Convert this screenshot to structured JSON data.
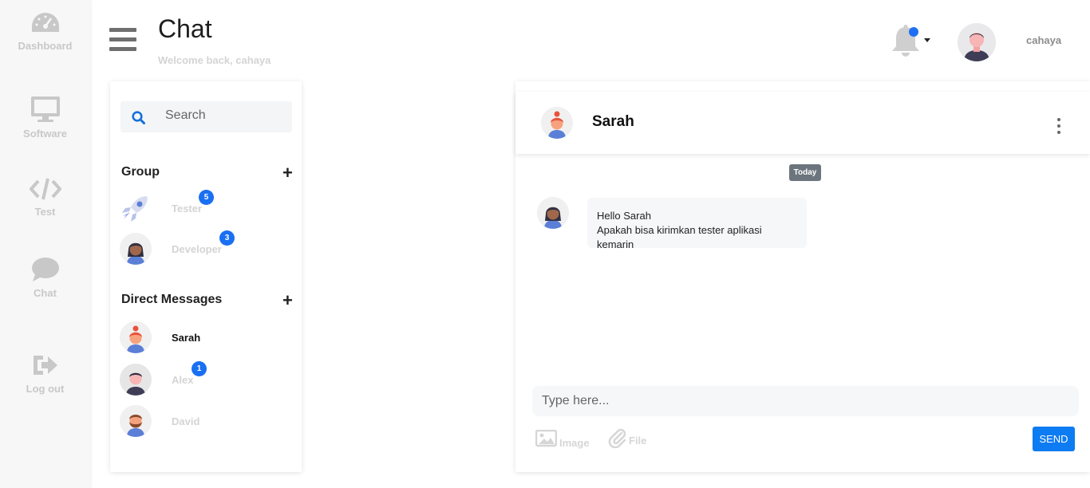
{
  "sidebar": {
    "items": [
      {
        "label": "Dashboard",
        "icon": "speedometer-icon"
      },
      {
        "label": "Software",
        "icon": "monitor-icon"
      },
      {
        "label": "Test",
        "icon": "code-icon"
      },
      {
        "label": "Chat",
        "icon": "chat-bubble-icon"
      },
      {
        "label": "Log out",
        "icon": "logout-icon"
      }
    ]
  },
  "header": {
    "title": "Chat",
    "subtitle": "Welcome back, cahaya",
    "user_name": "cahaya"
  },
  "contacts": {
    "search_placeholder": "Search",
    "group_title": "Group",
    "groups": [
      {
        "name": "Tester",
        "badge": "5",
        "avatar": "rocket-icon"
      },
      {
        "name": "Developer",
        "badge": "3",
        "avatar": "woman-avatar"
      }
    ],
    "dm_title": "Direct Messages",
    "direct_messages": [
      {
        "name": "Sarah",
        "badge": "",
        "avatar": "woman-redhead-avatar"
      },
      {
        "name": "Alex",
        "badge": "1",
        "avatar": "man-avatar"
      },
      {
        "name": "David",
        "badge": "",
        "avatar": "bearded-man-avatar"
      }
    ]
  },
  "chat": {
    "contact_name": "Sarah",
    "date_label": "Today",
    "messages": [
      {
        "lines": [
          "Hello Sarah",
          "Apakah bisa kirimkan tester aplikasi kemarin"
        ]
      }
    ],
    "input_placeholder": "Type here...",
    "image_label": "Image",
    "file_label": "File",
    "send_label": "SEND"
  },
  "colors": {
    "accent": "#0d7bf2",
    "badge": "#1a6ff2",
    "muted_text": "#d4d4d4",
    "today_pill": "#6c757d"
  }
}
